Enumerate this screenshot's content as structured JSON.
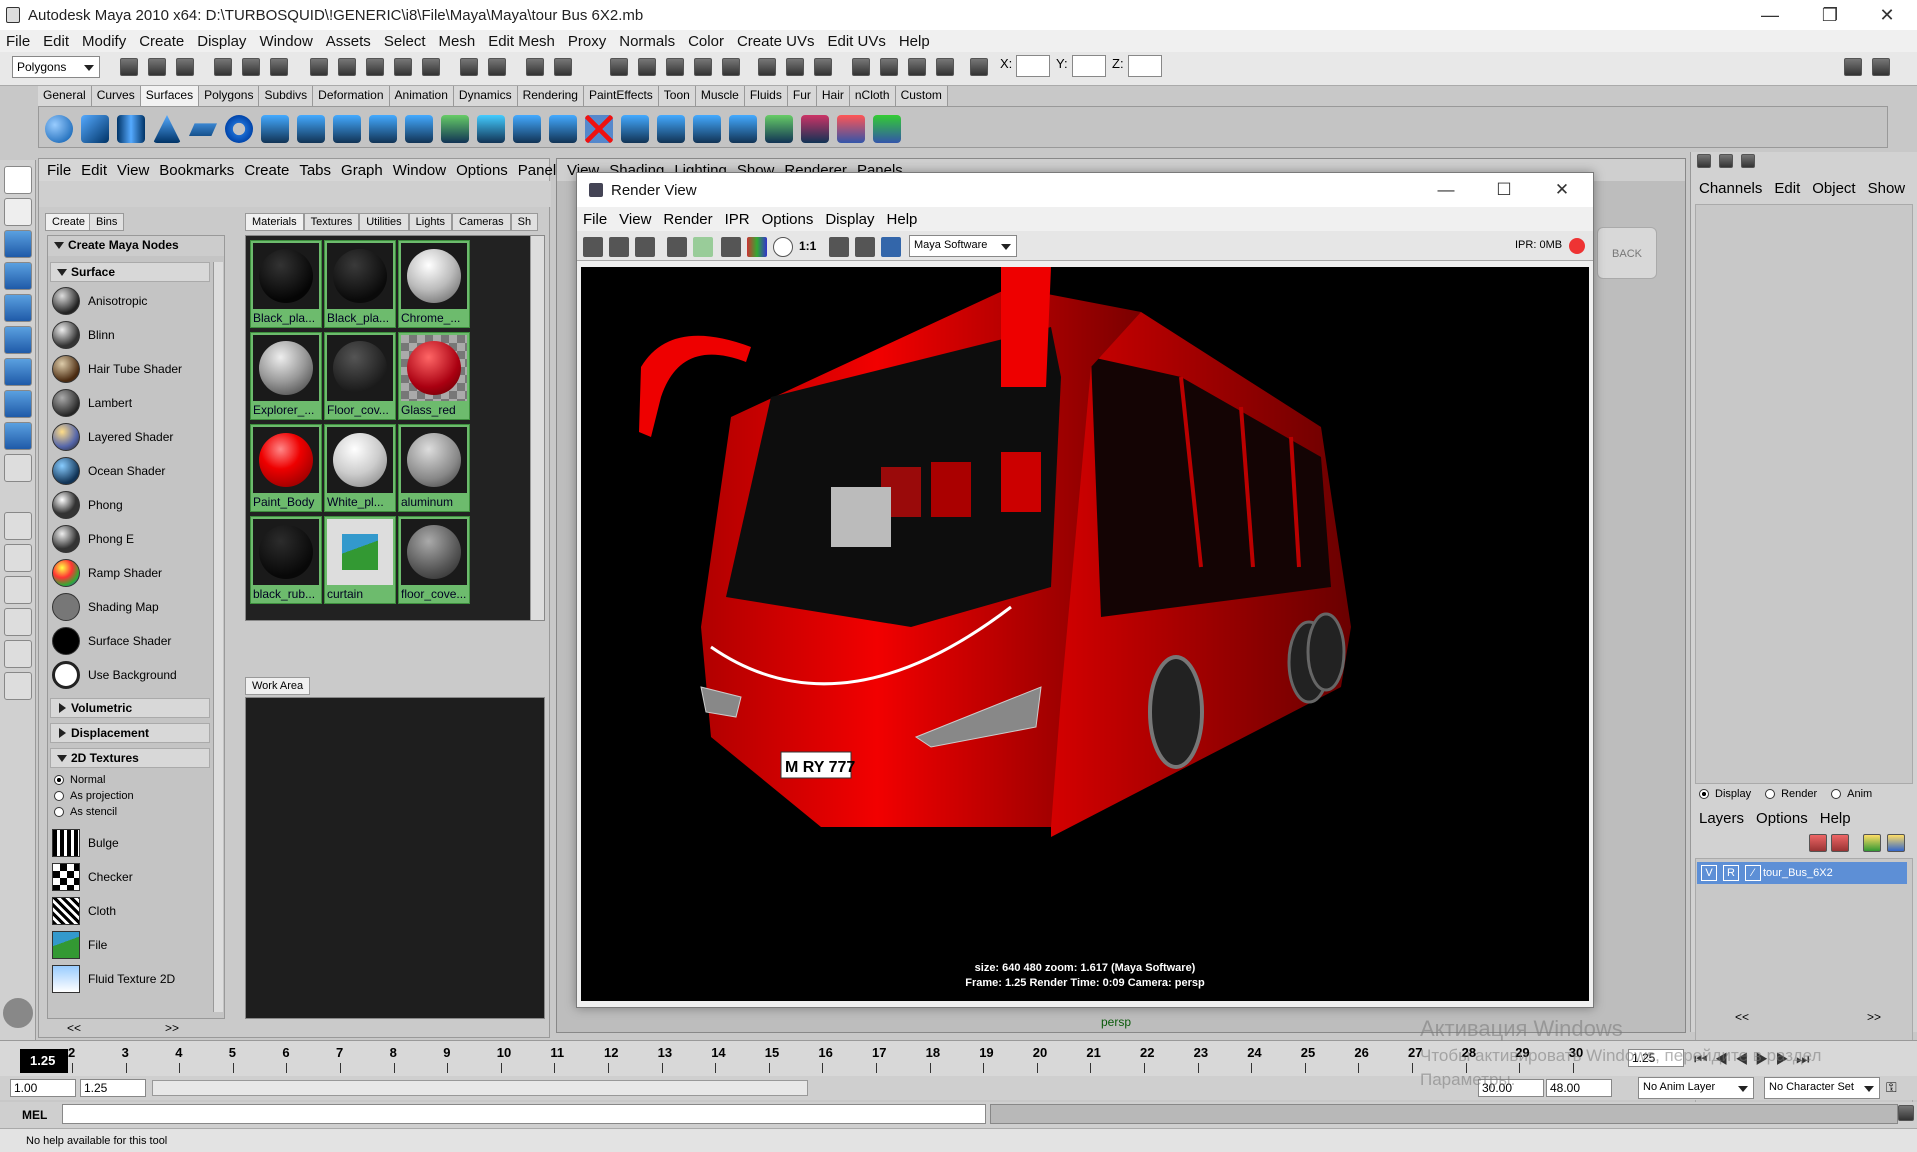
{
  "app": {
    "window_title": "Autodesk Maya 2010 x64: D:\\TURBOSQUID\\!GENERIC\\i8\\File\\Maya\\Maya\\tour Bus 6X2.mb"
  },
  "main_menu": [
    "File",
    "Edit",
    "Modify",
    "Create",
    "Display",
    "Window",
    "Assets",
    "Select",
    "Mesh",
    "Edit Mesh",
    "Proxy",
    "Normals",
    "Color",
    "Create UVs",
    "Edit UVs",
    "Help"
  ],
  "status_line": {
    "mode": "Polygons",
    "coord_labels": [
      "X:",
      "Y:",
      "Z:"
    ]
  },
  "shelf_tabs": [
    "General",
    "Curves",
    "Surfaces",
    "Polygons",
    "Subdivs",
    "Deformation",
    "Animation",
    "Dynamics",
    "Rendering",
    "PaintEffects",
    "Toon",
    "Muscle",
    "Fluids",
    "Fur",
    "Hair",
    "nCloth",
    "Custom"
  ],
  "shelf_active": "Surfaces",
  "hypershade": {
    "menu": [
      "File",
      "Edit",
      "View",
      "Bookmarks",
      "Create",
      "Tabs",
      "Graph",
      "Window",
      "Options",
      "Panels"
    ],
    "left_tabs": [
      "Create",
      "Bins"
    ],
    "create_header": "Create Maya Nodes",
    "surface_header": "Surface",
    "surface_nodes": [
      "Anisotropic",
      "Blinn",
      "Hair Tube Shader",
      "Lambert",
      "Layered Shader",
      "Ocean Shader",
      "Phong",
      "Phong E",
      "Ramp Shader",
      "Shading Map",
      "Surface Shader",
      "Use Background"
    ],
    "volumetric_header": "Volumetric",
    "displacement_header": "Displacement",
    "textures2d_header": "2D Textures",
    "texture_modes": [
      "Normal",
      "As projection",
      "As stencil"
    ],
    "texture_nodes": [
      "Bulge",
      "Checker",
      "Cloth",
      "File",
      "Fluid Texture 2D"
    ],
    "top_tabs": [
      "Materials",
      "Textures",
      "Utilities",
      "Lights",
      "Cameras",
      "Sh"
    ],
    "materials": [
      "Black_pla...",
      "Black_pla...",
      "Chrome_...",
      "Explorer_...",
      "Floor_cov...",
      "Glass_red",
      "Paint_Body",
      "White_pl...",
      "aluminum",
      "black_rub...",
      "curtain",
      "floor_cove..."
    ],
    "work_area_tab": "Work Area",
    "scroll_left": "<<",
    "scroll_right": ">>"
  },
  "viewport": {
    "menu": [
      "View",
      "Shading",
      "Lighting",
      "Show",
      "Renderer",
      "Panels"
    ],
    "camera_label": "persp",
    "cube_label": "BACK"
  },
  "render_view": {
    "title": "Render View",
    "menu": [
      "File",
      "View",
      "Render",
      "IPR",
      "Options",
      "Display",
      "Help"
    ],
    "ratio_label": "1:1",
    "renderer": "Maya Software",
    "ipr_label": "IPR: 0MB",
    "info_line1": "size:  640  480 zoom: 1.617      (Maya Software)",
    "info_line2": "Frame: 1.25      Render Time: 0:09      Camera: persp",
    "plate_text": "M RY 777"
  },
  "channel_box": {
    "menu": [
      "Channels",
      "Edit",
      "Object",
      "Show"
    ],
    "layer_modes": [
      "Display",
      "Render",
      "Anim"
    ],
    "layer_menu": [
      "Layers",
      "Options",
      "Help"
    ],
    "layer_name": "tour_Bus_6X2",
    "layer_flags": [
      "V",
      "R"
    ],
    "scroll_left": "<<",
    "scroll_right": ">>"
  },
  "timeline": {
    "current_frame": "1.25",
    "ticks": [
      "2",
      "3",
      "4",
      "5",
      "6",
      "7",
      "8",
      "9",
      "10",
      "11",
      "12",
      "13",
      "14",
      "15",
      "16",
      "17",
      "18",
      "19",
      "20",
      "21",
      "22",
      "23",
      "24",
      "25",
      "26",
      "27",
      "28",
      "29",
      "30"
    ],
    "current_field": "1.25"
  },
  "range": {
    "start": "1.00",
    "current": "1.25",
    "end_a": "30.00",
    "end_b": "48.00",
    "anim_layer": "No Anim Layer",
    "char_set": "No Character Set"
  },
  "command_line": {
    "label": "MEL"
  },
  "help_line": "No help available for this tool",
  "watermark": {
    "line1": "Активация Windows",
    "line2": "Чтобы активировать Windows, перейдите в раздел",
    "line3": "Параметры."
  }
}
